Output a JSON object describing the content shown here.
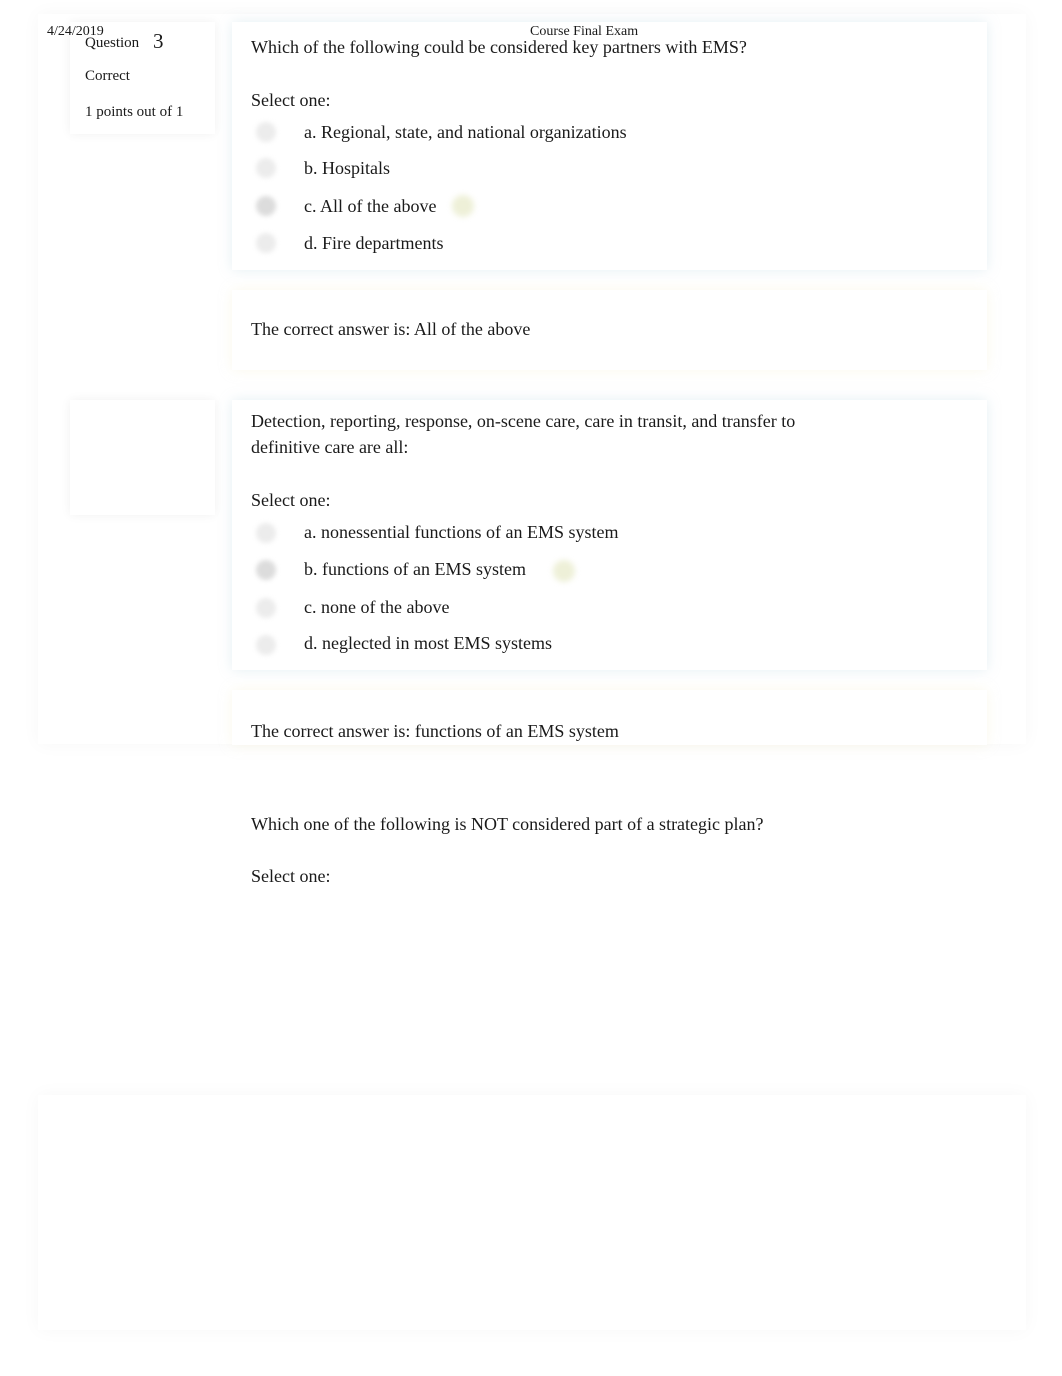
{
  "header": {
    "date": "4/24/2019",
    "title": "Course Final Exam"
  },
  "questions": [
    {
      "number_label": "Question",
      "number": "3",
      "state": "Correct",
      "grade": "1 points out of 1",
      "text_lines": [
        "Which of the following could be considered key partners with EMS?"
      ],
      "prompt": "Select one:",
      "options": [
        {
          "label": "a. Regional, state, and national organizations",
          "selected": false
        },
        {
          "label": "b. Hospitals",
          "selected": false
        },
        {
          "label": "c. All of the above",
          "selected": true,
          "icon": "check-icon"
        },
        {
          "label": "d. Fire departments",
          "selected": false
        }
      ],
      "feedback": "The correct answer is: All of the above"
    },
    {
      "text_lines": [
        "Detection, reporting, response, on-scene care, care in transit, and transfer to",
        "definitive care are all:"
      ],
      "prompt": "Select one:",
      "options": [
        {
          "label": "a. nonessential functions of an EMS system",
          "selected": false
        },
        {
          "label": "b. functions of an EMS system",
          "selected": true,
          "icon": "check-icon"
        },
        {
          "label": "c. none of the above",
          "selected": false
        },
        {
          "label": "d. neglected in most EMS systems",
          "selected": false
        }
      ],
      "feedback": "The correct answer is: functions of an EMS system"
    },
    {
      "text_lines": [
        "Which one of the following is NOT considered part of a strategic plan?"
      ],
      "prompt": "Select one:"
    }
  ]
}
